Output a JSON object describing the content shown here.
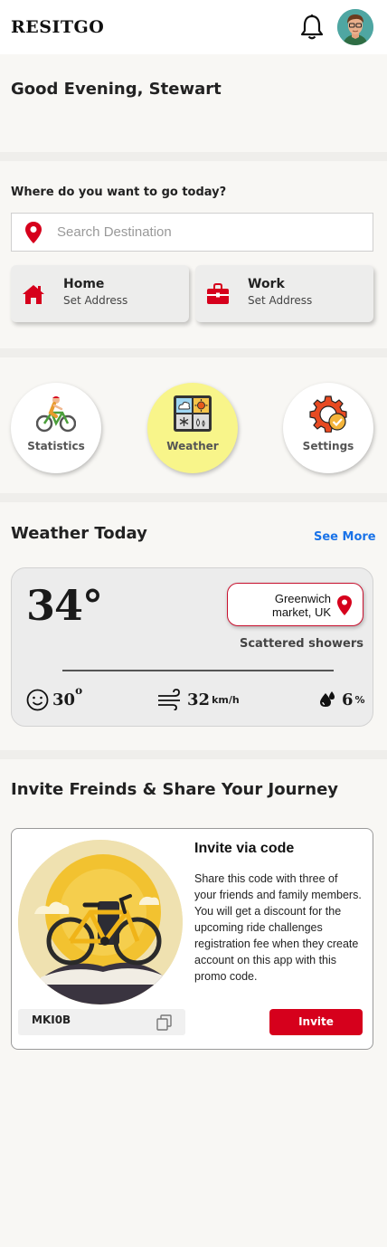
{
  "app": {
    "name": "RESITGO"
  },
  "header": {
    "notification_icon": "bell-icon",
    "avatar_icon": "user-avatar"
  },
  "greeting": {
    "text": "Good Evening, Stewart"
  },
  "destination": {
    "question": "Where do you want to go today?",
    "search_placeholder": "Search Destination",
    "shortcuts": [
      {
        "title": "Home",
        "subtitle": "Set Address",
        "icon": "home-icon"
      },
      {
        "title": "Work",
        "subtitle": "Set Address",
        "icon": "briefcase-icon"
      }
    ]
  },
  "quick_actions": [
    {
      "label": "Statistics",
      "icon": "cyclist-icon",
      "active": false
    },
    {
      "label": "Weather",
      "icon": "weather-grid-icon",
      "active": true
    },
    {
      "label": "Settings",
      "icon": "settings-gear-icon",
      "active": false
    }
  ],
  "weather": {
    "title": "Weather Today",
    "see_more": "See More",
    "temperature": "34°",
    "location": "Greenwich market, UK",
    "condition": "Scattered showers",
    "feels_like": "30",
    "feels_like_deg": "o",
    "wind_value": "32",
    "wind_unit": "km/h",
    "humidity_value": "6",
    "humidity_unit": "%"
  },
  "invite": {
    "section_title": "Invite Freinds & Share Your Journey",
    "card_title": "Invite via code",
    "body": "Share this code with three of your friends and family members. You will get a discount for the upcoming ride challenges registration fee when they create account on this app with this promo code.",
    "code": "MKI0B",
    "button": "Invite"
  },
  "colors": {
    "brand_red": "#d6001c",
    "link_blue": "#1a73e8",
    "weather_active": "#f8f58a"
  }
}
